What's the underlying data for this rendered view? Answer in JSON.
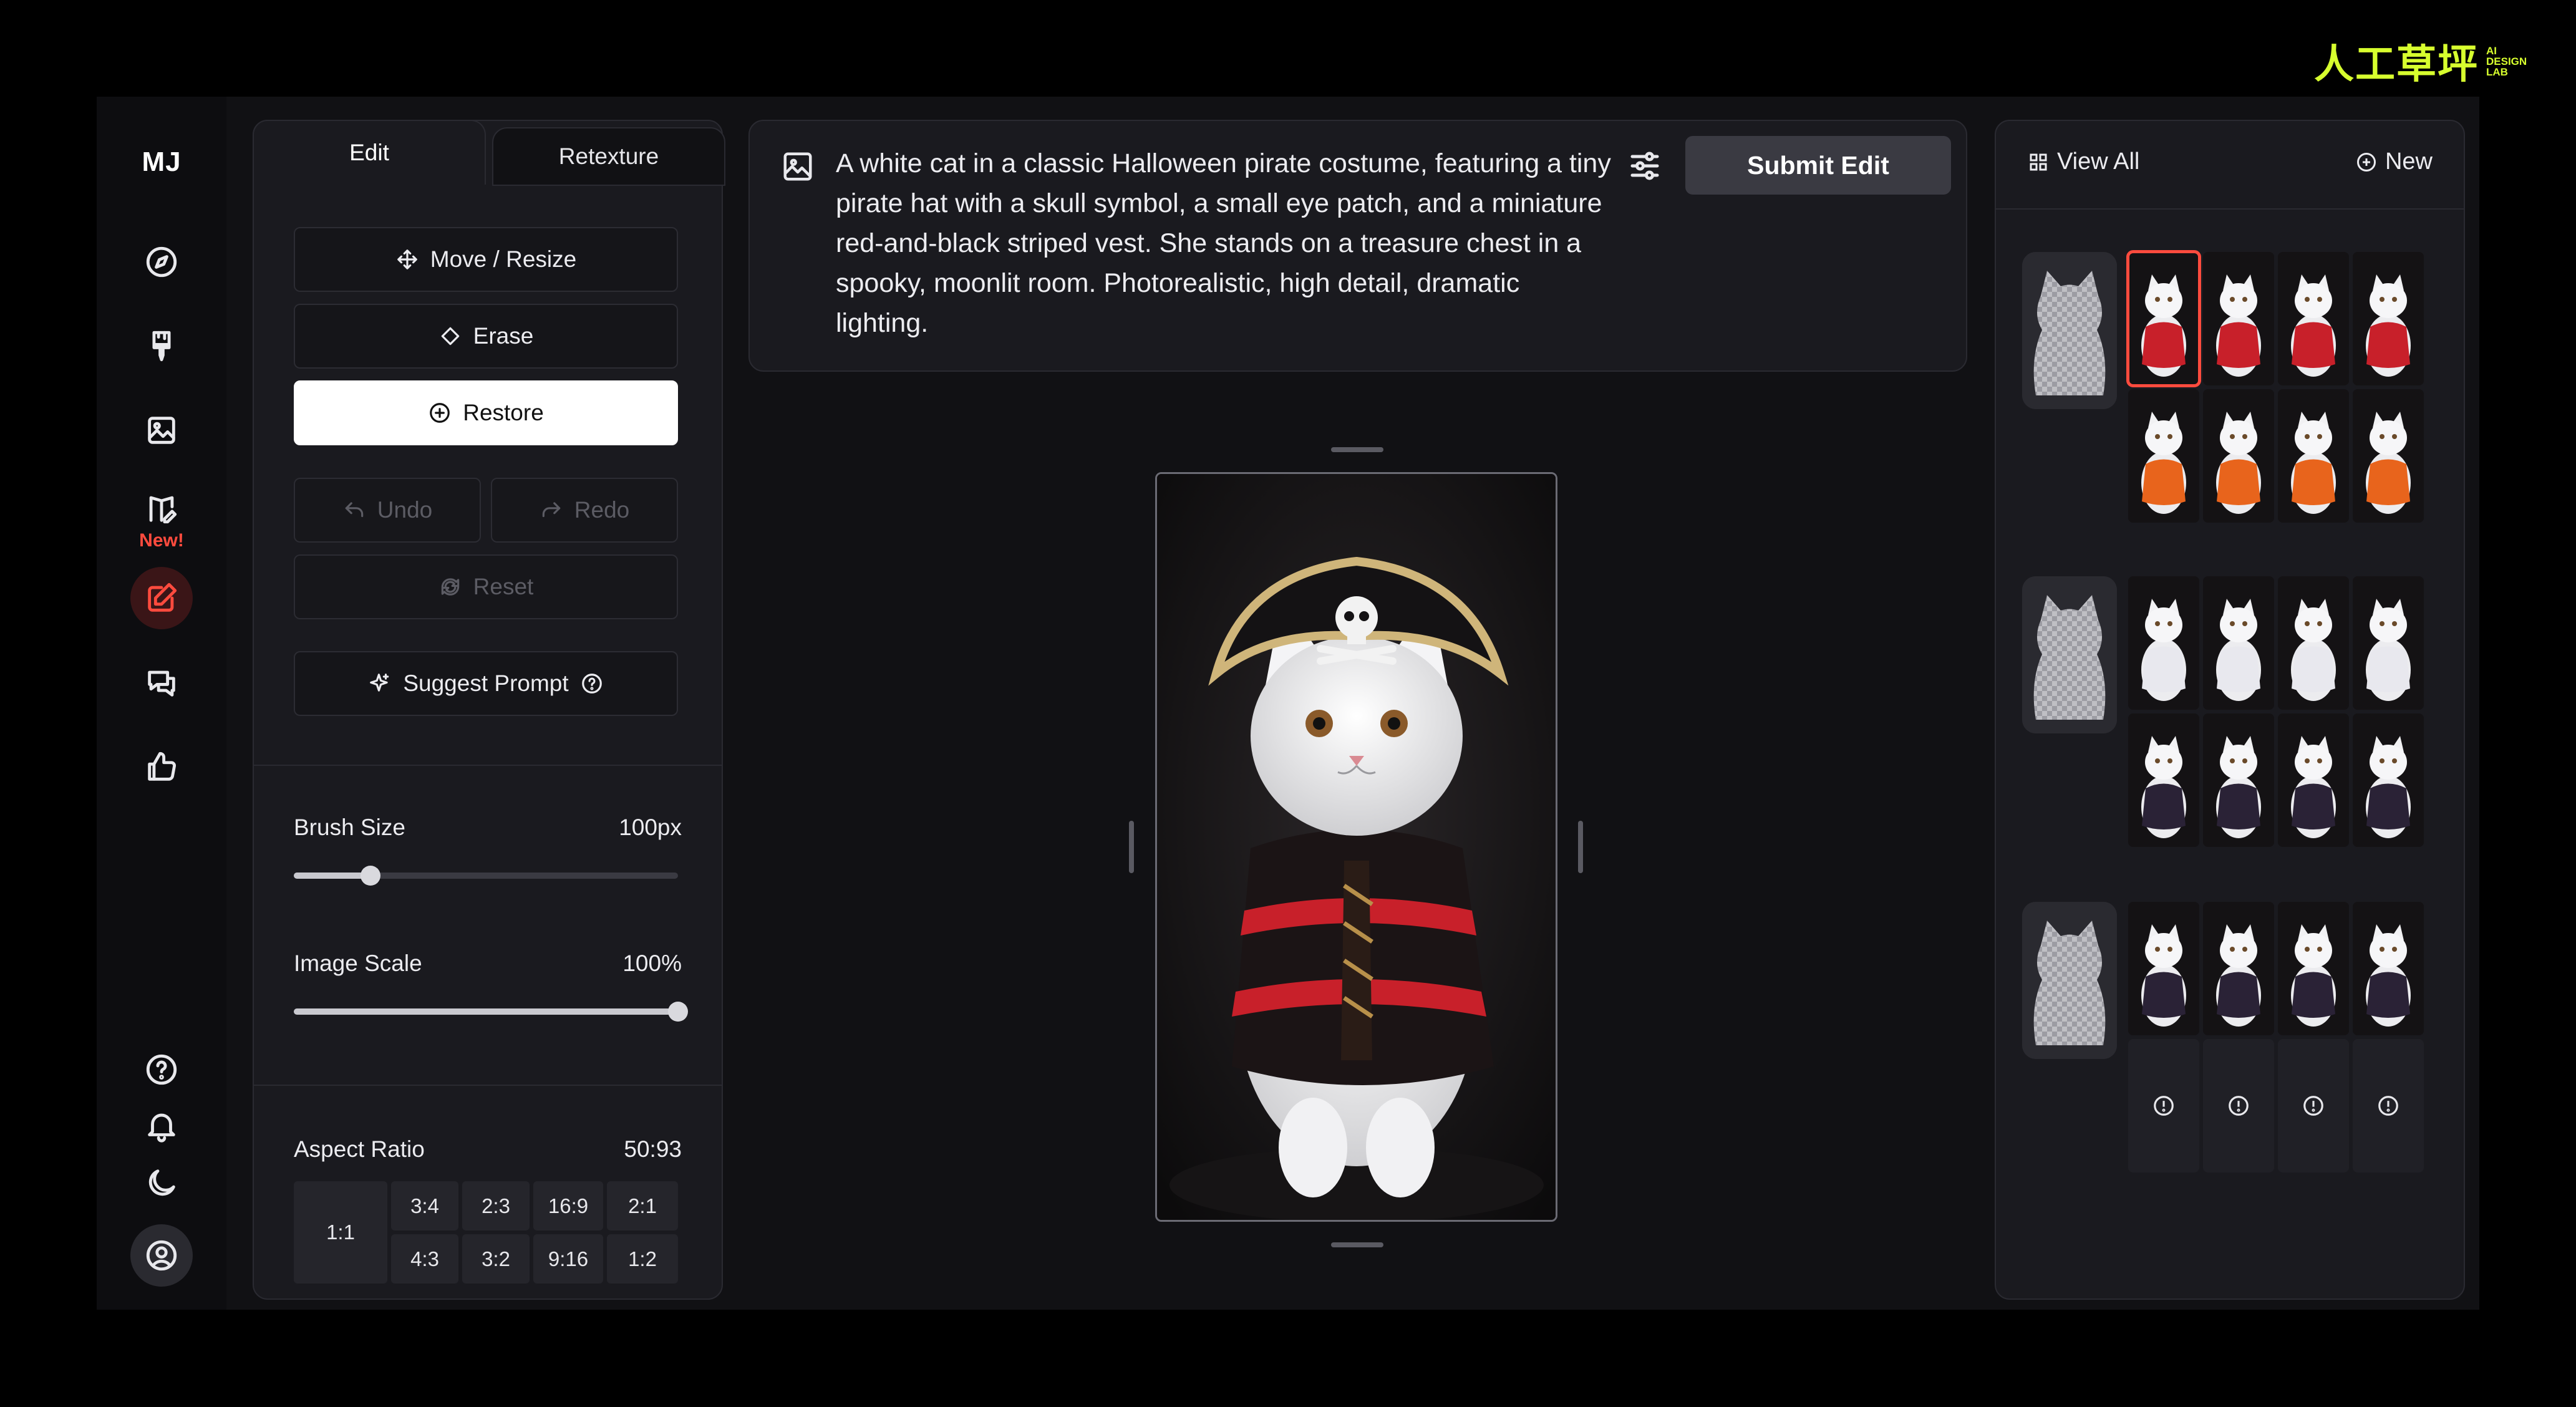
{
  "watermark": {
    "logo": "人工草坪",
    "sub": [
      "AI",
      "DESIGN",
      "LAB"
    ]
  },
  "rail": {
    "logo": "MJ",
    "new_badge": "New!",
    "icons": [
      "compass-icon",
      "brush-icon",
      "image-icon",
      "edit-sparkle-icon",
      "edit-icon",
      "chat-icon",
      "thumbs-up-icon",
      "help-icon",
      "bell-icon",
      "moon-icon",
      "profile-icon"
    ]
  },
  "tools": {
    "tabs": {
      "edit": "Edit",
      "retexture": "Retexture"
    },
    "move_resize": "Move / Resize",
    "erase": "Erase",
    "restore": "Restore",
    "undo": "Undo",
    "redo": "Redo",
    "reset": "Reset",
    "suggest_prompt": "Suggest Prompt",
    "brush_size": {
      "label": "Brush Size",
      "value": "100px",
      "fraction": 0.2
    },
    "image_scale": {
      "label": "Image Scale",
      "value": "100%",
      "fraction": 1.0
    },
    "aspect_ratio": {
      "label": "Aspect Ratio",
      "value": "50:93",
      "options": [
        "1:1",
        "3:4",
        "2:3",
        "16:9",
        "2:1",
        "4:3",
        "3:2",
        "9:16",
        "1:2"
      ]
    }
  },
  "prompt": {
    "text": "A white cat in a classic Halloween pirate costume, featuring a tiny pirate hat with a skull symbol, a small eye patch, and a miniature red-and-black striped vest. She stands on a treasure chest in a spooky, moonlit room. Photorealistic, high detail, dramatic lighting.",
    "submit": "Submit Edit"
  },
  "gallery": {
    "view_all": "View All",
    "new": "New",
    "colors": {
      "accent": "#ff4b3e",
      "pirate": "#c8202a",
      "pumpkin": "#e8641c",
      "ghost": "#e8e8ee",
      "witch": "#2a2236"
    }
  }
}
